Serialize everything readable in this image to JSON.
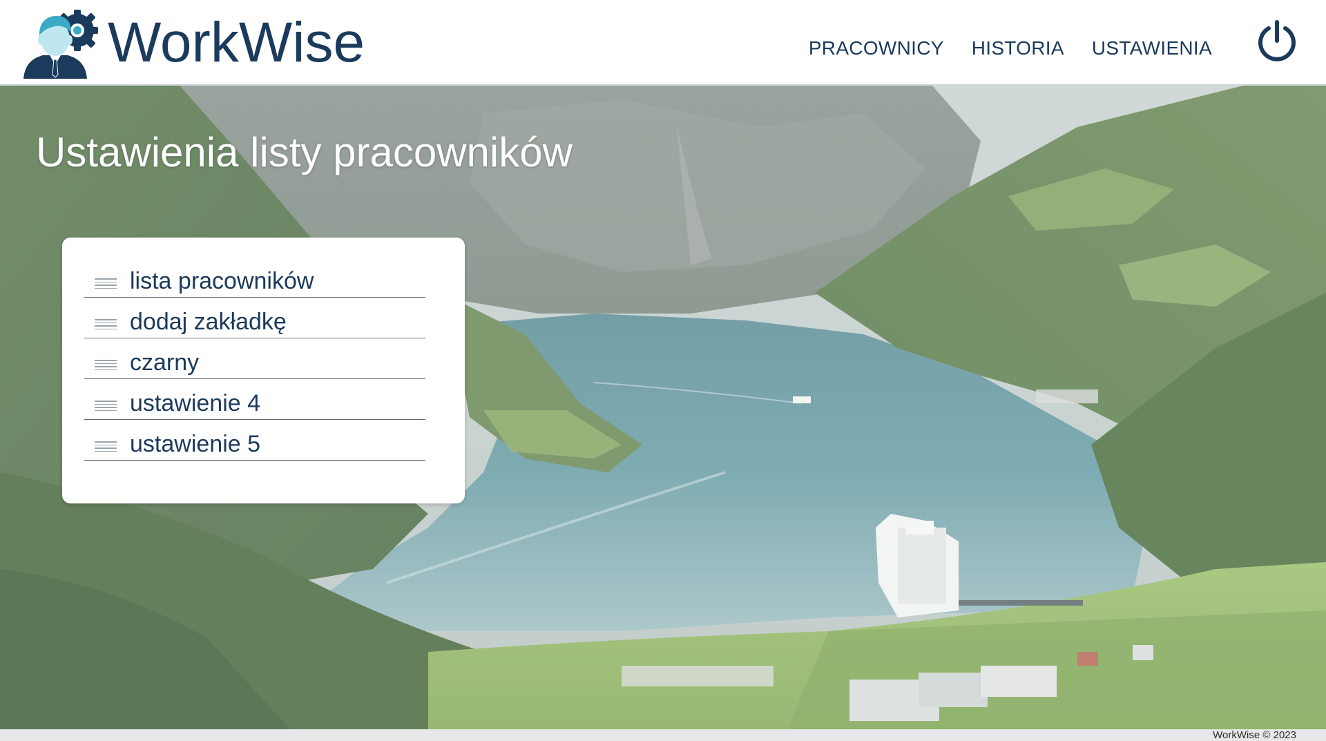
{
  "brand": {
    "name": "WorkWise",
    "colors": {
      "primary": "#1b3a5c",
      "accent": "#3aa9c6"
    }
  },
  "nav": {
    "items": [
      {
        "label": "PRACOWNICY"
      },
      {
        "label": "HISTORIA"
      },
      {
        "label": "USTAWIENIA"
      }
    ],
    "power_icon": "power-icon"
  },
  "page": {
    "title": "Ustawienia listy pracowników"
  },
  "settings": {
    "items": [
      {
        "label": "lista pracowników",
        "icon": "drag-handle-icon"
      },
      {
        "label": "dodaj zakładkę",
        "icon": "drag-handle-icon"
      },
      {
        "label": "czarny",
        "icon": "drag-handle-icon"
      },
      {
        "label": "ustawienie 4",
        "icon": "drag-handle-icon"
      },
      {
        "label": "ustawienie 5",
        "icon": "drag-handle-icon"
      }
    ]
  },
  "footer": {
    "text": "WorkWise © 2023"
  }
}
